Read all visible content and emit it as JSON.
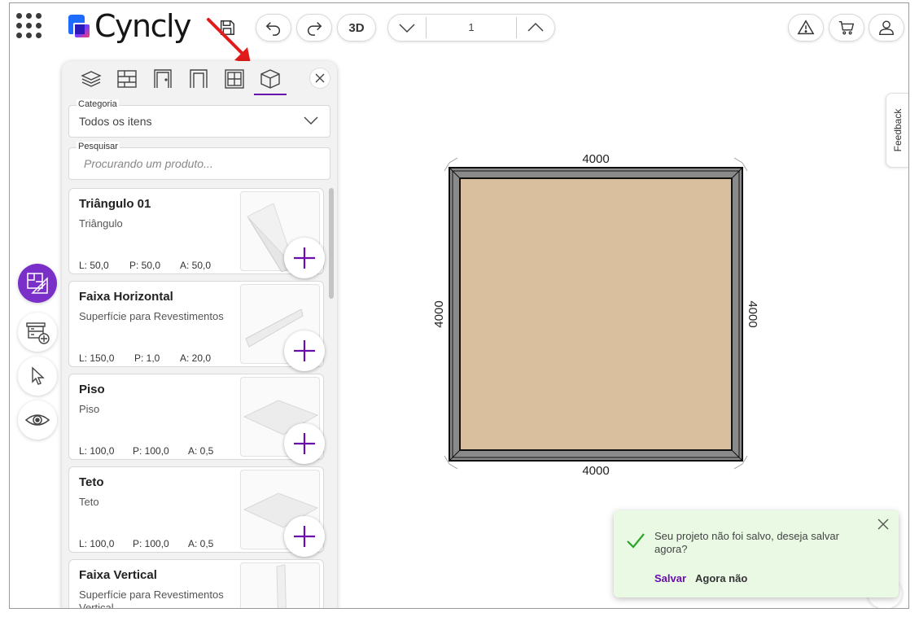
{
  "app": {
    "brand": "Cyncly"
  },
  "toolbar": {
    "view_3d_label": "3D",
    "level_value": "1"
  },
  "panel": {
    "tabs": [
      "layers-icon",
      "wall-icon",
      "door-icon",
      "opening-icon",
      "window-icon",
      "cube-icon"
    ],
    "active_tab": "cube-icon",
    "category": {
      "label": "Categoria",
      "value": "Todos os itens"
    },
    "search": {
      "label": "Pesquisar",
      "placeholder": "Procurando um produto..."
    },
    "items": [
      {
        "name": "Triângulo 01",
        "desc": "Triângulo",
        "l": "L: 50,0",
        "p": "P: 50,0",
        "a": "A: 50,0",
        "thumb": "triangle"
      },
      {
        "name": "Faixa Horizontal",
        "desc": "Superfície para Revestimentos",
        "l": "L: 150,0",
        "p": "P: 1,0",
        "a": "A: 20,0",
        "thumb": "strip-h"
      },
      {
        "name": "Piso",
        "desc": "Piso",
        "l": "L: 100,0",
        "p": "P: 100,0",
        "a": "A: 0,5",
        "thumb": "plane"
      },
      {
        "name": "Teto",
        "desc": "Teto",
        "l": "L: 100,0",
        "p": "P: 100,0",
        "a": "A: 0,5",
        "thumb": "plane"
      },
      {
        "name": "Faixa Vertical",
        "desc": "Superfície para Revestimentos Vertical",
        "l": "",
        "p": "",
        "a": "",
        "thumb": "strip-v"
      }
    ]
  },
  "drawing": {
    "dim_top": "4000",
    "dim_bottom": "4000",
    "dim_left": "4000",
    "dim_right": "4000",
    "floor_color": "#d9bf9e",
    "wall_color": "#8a8a8a"
  },
  "feedback_label": "Feedback",
  "toast": {
    "message": "Seu projeto não foi salvo, deseja salvar agora?",
    "save_label": "Salvar",
    "later_label": "Agora não"
  },
  "colors": {
    "accent": "#6a0dad",
    "toast_bg": "#e9f9e4",
    "check": "#2aa52a"
  }
}
